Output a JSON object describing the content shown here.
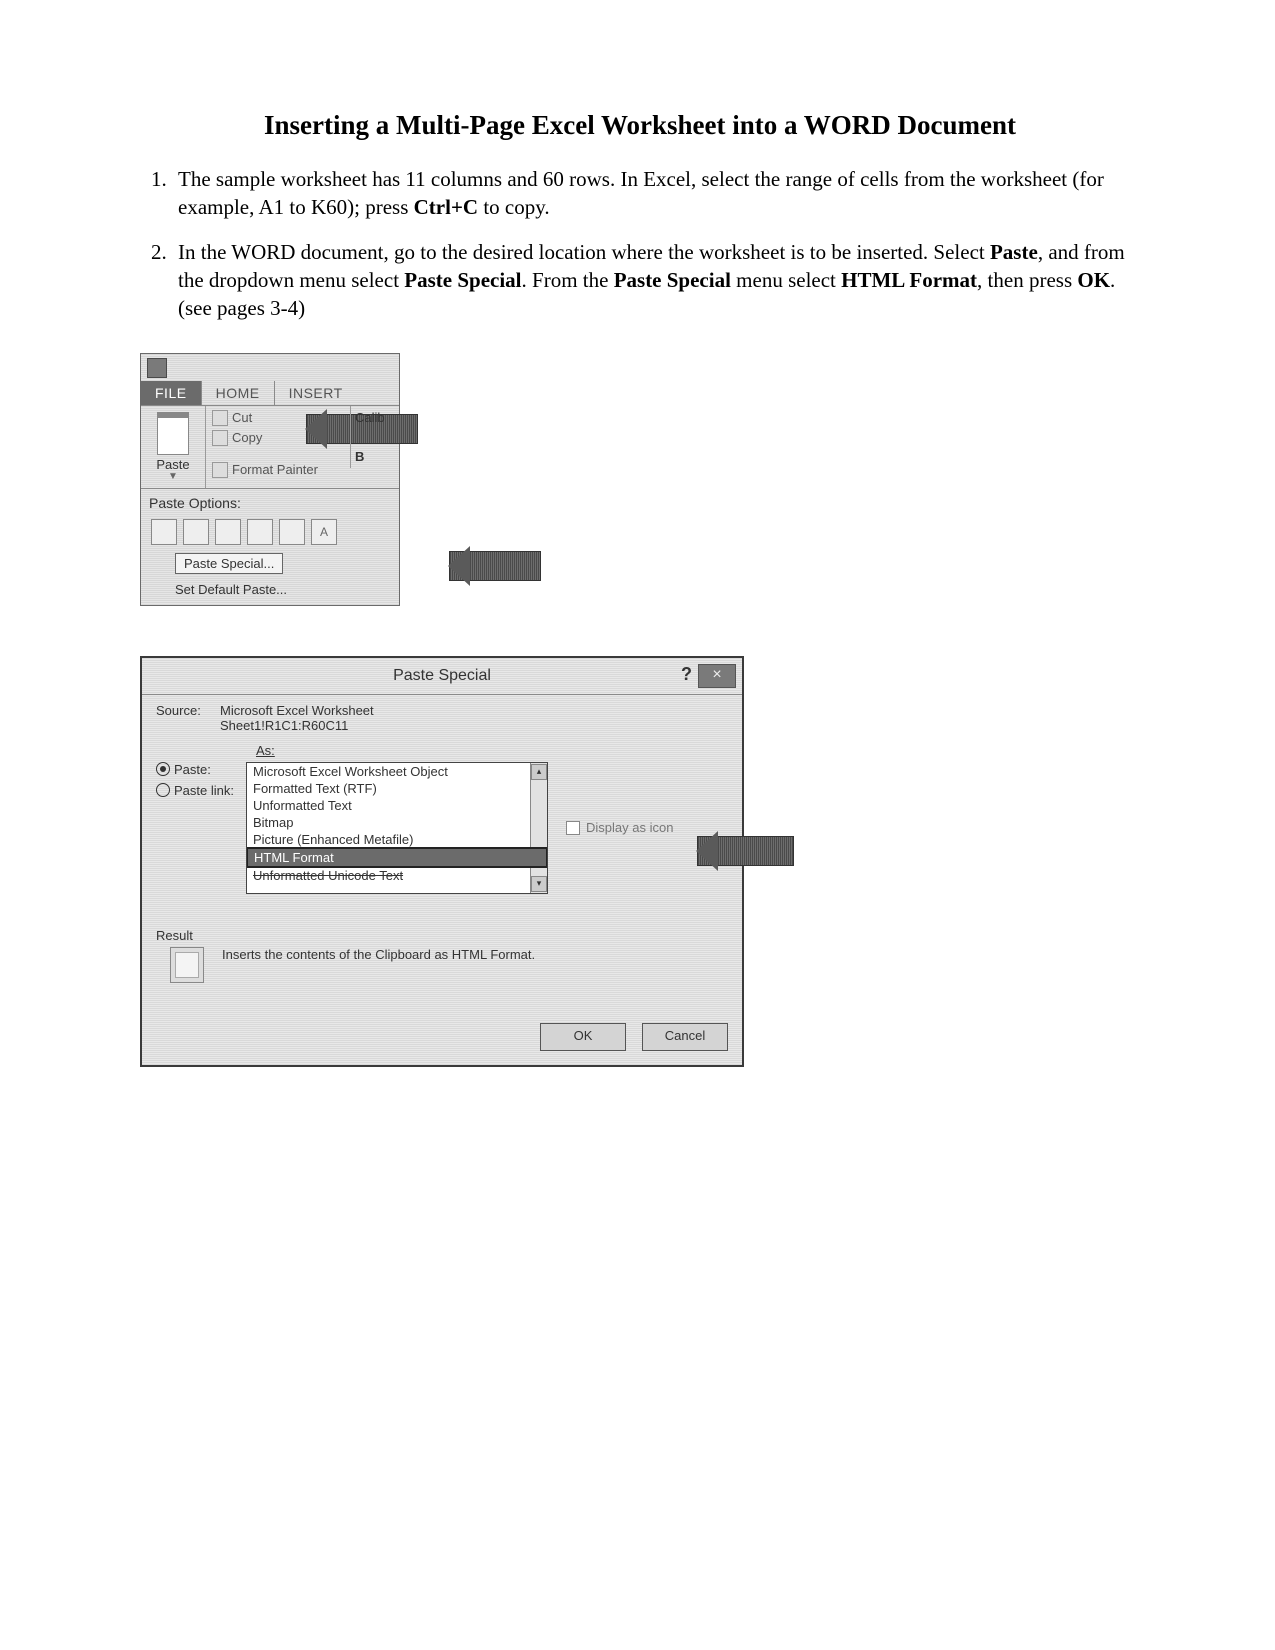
{
  "title": "Inserting a Multi-Page Excel Worksheet into a WORD Document",
  "steps": {
    "s1a": "The sample worksheet has 11 columns and 60 rows. In Excel, select the range of cells from the worksheet (for example, A1 to K60); press ",
    "s1b": "Ctrl+C",
    "s1c": " to copy.",
    "s2a": "In the WORD document, go to the desired location where the worksheet is to be inserted. Select ",
    "s2b": "Paste",
    "s2c": ", and from the dropdown menu select ",
    "s2d": "Paste Special",
    "s2e": ". From the ",
    "s2f": "Paste Special",
    "s2g": " menu select ",
    "s2h": "HTML Format",
    "s2i": ", then press ",
    "s2j": "OK",
    "s2k": ". (see pages 3-4)"
  },
  "ribbon": {
    "tab_file": "FILE",
    "tab_home": "HOME",
    "tab_insert": "INSERT",
    "paste": "Paste",
    "cut": "Cut",
    "copy": "Copy",
    "fmt_painter": "Format Painter",
    "font_hint": "Calib",
    "bold_hint": "B",
    "po_label": "Paste Options:",
    "paste_special": "Paste Special...",
    "set_default": "Set Default Paste..."
  },
  "dialog": {
    "title": "Paste Special",
    "help": "?",
    "close": "×",
    "source_lbl": "Source:",
    "source_val1": "Microsoft Excel Worksheet",
    "source_val2": "Sheet1!R1C1:R60C11",
    "as_lbl": "As:",
    "radio_paste": "Paste:",
    "radio_link": "Paste link:",
    "opts": [
      "Microsoft Excel Worksheet Object",
      "Formatted Text (RTF)",
      "Unformatted Text",
      "Bitmap",
      "Picture (Enhanced Metafile)",
      "HTML Format",
      "Unformatted Unicode Text"
    ],
    "display_icon": "Display as icon",
    "result_lbl": "Result",
    "result_text": "Inserts the contents of the Clipboard as HTML Format.",
    "ok": "OK",
    "cancel": "Cancel"
  }
}
